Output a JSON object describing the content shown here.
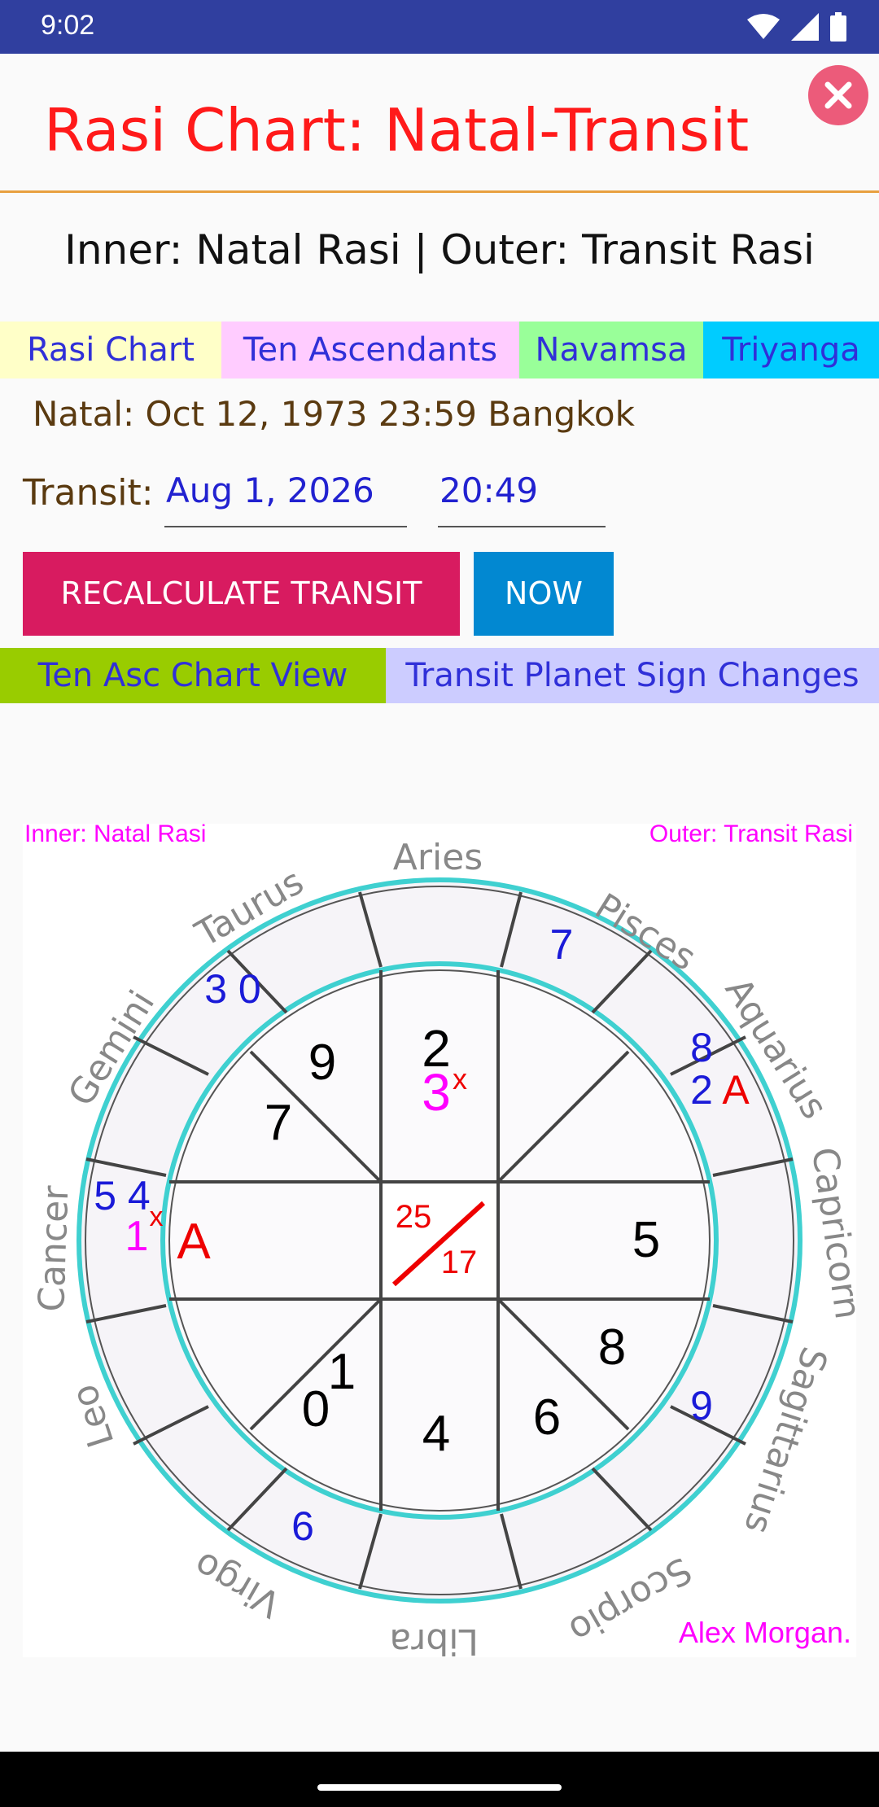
{
  "status_bar": {
    "time": "9:02"
  },
  "header": {
    "title": "Rasi Chart: Natal-Transit"
  },
  "subtitle": "Inner: Natal Rasi | Outer: Transit Rasi",
  "tabs": [
    {
      "label": "Rasi Chart",
      "color": "#ffffc8"
    },
    {
      "label": "Ten Ascendants",
      "color": "#ffccff"
    },
    {
      "label": "Navamsa",
      "color": "#99ff99"
    },
    {
      "label": "Triyanga",
      "color": "#00ccff"
    }
  ],
  "natal": "Natal: Oct 12, 1973 23:59 Bangkok",
  "transit": {
    "label": "Transit:",
    "date": "Aug 1, 2026",
    "time": "20:49"
  },
  "buttons": {
    "recalculate": {
      "label": "RECALCULATE TRANSIT",
      "color": "#d81b60"
    },
    "now": {
      "label": "NOW",
      "color": "#0288d1"
    }
  },
  "tabs2": [
    {
      "label": "Ten Asc Chart View",
      "color": "#99cc00"
    },
    {
      "label": "Transit Planet Sign Changes",
      "color": "#ccccff"
    }
  ],
  "chart": {
    "inner_caption": "Inner: Natal Rasi",
    "outer_caption": "Outer: Transit Rasi",
    "signature": "Alex  Morgan.",
    "signs": [
      "Aries",
      "Pisces",
      "Aquarius",
      "Capricorn",
      "Sagittarius",
      "Scorpio",
      "Libra",
      "Virgo",
      "Leo",
      "Cancer",
      "Gemini",
      "Taurus"
    ],
    "center_top": "25",
    "center_bottom": "17",
    "inner_labels": [
      {
        "text": "2",
        "color": "black"
      },
      {
        "text": "3",
        "color": "magenta"
      },
      {
        "text": "x",
        "color": "red"
      },
      {
        "text": "9",
        "color": "black"
      },
      {
        "text": "7",
        "color": "black"
      },
      {
        "text": "A",
        "color": "red"
      },
      {
        "text": "1",
        "color": "black"
      },
      {
        "text": "0",
        "color": "black"
      },
      {
        "text": "4",
        "color": "black"
      },
      {
        "text": "6",
        "color": "black"
      },
      {
        "text": "8",
        "color": "black"
      },
      {
        "text": "5",
        "color": "black"
      }
    ],
    "outer_labels": [
      {
        "text": "7",
        "color": "blue"
      },
      {
        "text": "8",
        "color": "blue"
      },
      {
        "text": "2",
        "color": "blue"
      },
      {
        "text": "A",
        "color": "red"
      },
      {
        "text": "3 0",
        "color": "blue"
      },
      {
        "text": "5 4",
        "color": "blue"
      },
      {
        "text": "1",
        "color": "magenta"
      },
      {
        "text": "x",
        "color": "red"
      },
      {
        "text": "9",
        "color": "blue"
      },
      {
        "text": "6",
        "color": "blue"
      }
    ]
  }
}
